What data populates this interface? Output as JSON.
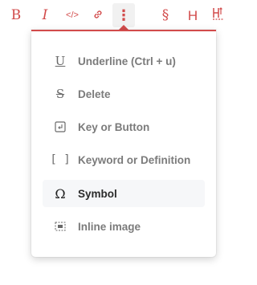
{
  "toolbar": {
    "accent_color": "#d24b4b",
    "buttons": [
      {
        "name": "bold-button",
        "glyph": "B",
        "icon": "bold-icon"
      },
      {
        "name": "italic-button",
        "glyph": "I",
        "icon": "italic-icon"
      },
      {
        "name": "code-button",
        "glyph": "</>",
        "icon": "code-icon"
      },
      {
        "name": "link-button",
        "glyph": "🔗",
        "icon": "link-icon"
      },
      {
        "name": "more-button",
        "glyph": "⋮",
        "icon": "more-vertical-icon",
        "active": true
      },
      {
        "name": "section-button",
        "glyph": "§",
        "icon": "section-icon"
      },
      {
        "name": "heading-button",
        "glyph": "H",
        "icon": "heading-icon"
      },
      {
        "name": "spacing-button",
        "glyph": "⇕",
        "icon": "line-spacing-icon"
      }
    ]
  },
  "menu": {
    "items": [
      {
        "label": "Underline (Ctrl + u)",
        "icon": "underline-icon",
        "glyph": "U"
      },
      {
        "label": "Delete",
        "icon": "strikethrough-icon",
        "glyph": "S"
      },
      {
        "label": "Key or Button",
        "icon": "key-icon",
        "glyph": "↵"
      },
      {
        "label": "Keyword or Definition",
        "icon": "brackets-icon",
        "glyph": "[ ]"
      },
      {
        "label": "Symbol",
        "icon": "omega-icon",
        "glyph": "Ω",
        "selected": true
      },
      {
        "label": "Inline image",
        "icon": "inline-image-icon",
        "glyph": "▣"
      }
    ]
  }
}
